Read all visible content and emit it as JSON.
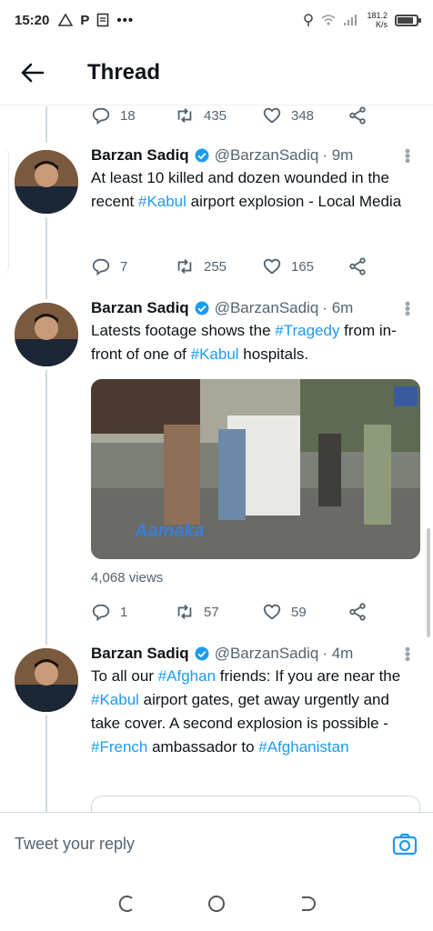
{
  "status_bar": {
    "time": "15:20",
    "notif_icons": [
      "warning-triangle-icon",
      "p-icon",
      "doc-icon",
      "more-dots-icon"
    ],
    "net_speed_value": "181.2",
    "net_speed_unit": "K/s",
    "battery_level": 0.85
  },
  "header": {
    "title": "Thread"
  },
  "prev_actions": {
    "replies": "18",
    "retweets": "435",
    "likes": "348"
  },
  "tweets": [
    {
      "name": "Barzan Sadiq",
      "handle": "@BarzanSadiq",
      "time": "· 9m",
      "text": [
        {
          "t": "At least 10 killed and dozen wounded in the recent "
        },
        {
          "t": "#Kabul",
          "tag": true
        },
        {
          "t": " airport explosion - Local Media"
        }
      ],
      "replies": "7",
      "retweets": "255",
      "likes": "165"
    },
    {
      "name": "Barzan Sadiq",
      "handle": "@BarzanSadiq",
      "time": "· 6m",
      "text": [
        {
          "t": "Latests footage shows the "
        },
        {
          "t": "#Tragedy",
          "tag": true
        },
        {
          "t": " from in-front of one of "
        },
        {
          "t": "#Kabul",
          "tag": true
        },
        {
          "t": " hospitals."
        }
      ],
      "media_watermark": "Aamaka",
      "views": "4,068 views",
      "replies": "1",
      "retweets": "57",
      "likes": "59"
    },
    {
      "name": "Barzan Sadiq",
      "handle": "@BarzanSadiq",
      "time": "· 4m",
      "text": [
        {
          "t": "To all our "
        },
        {
          "t": "#Afghan",
          "tag": true
        },
        {
          "t": " friends: If you are near the "
        },
        {
          "t": "#Kabul",
          "tag": true
        },
        {
          "t": " airport gates, get away urgently and take cover. A second explosion is possible - "
        },
        {
          "t": "#French",
          "tag": true
        },
        {
          "t": " ambassador to "
        },
        {
          "t": "#Afghanistan",
          "tag": true
        }
      ]
    }
  ],
  "reply_bar": {
    "placeholder": "Tweet your reply"
  },
  "colors": {
    "accent": "#1d9bf0",
    "text": "#0f1419",
    "muted": "#536471"
  }
}
